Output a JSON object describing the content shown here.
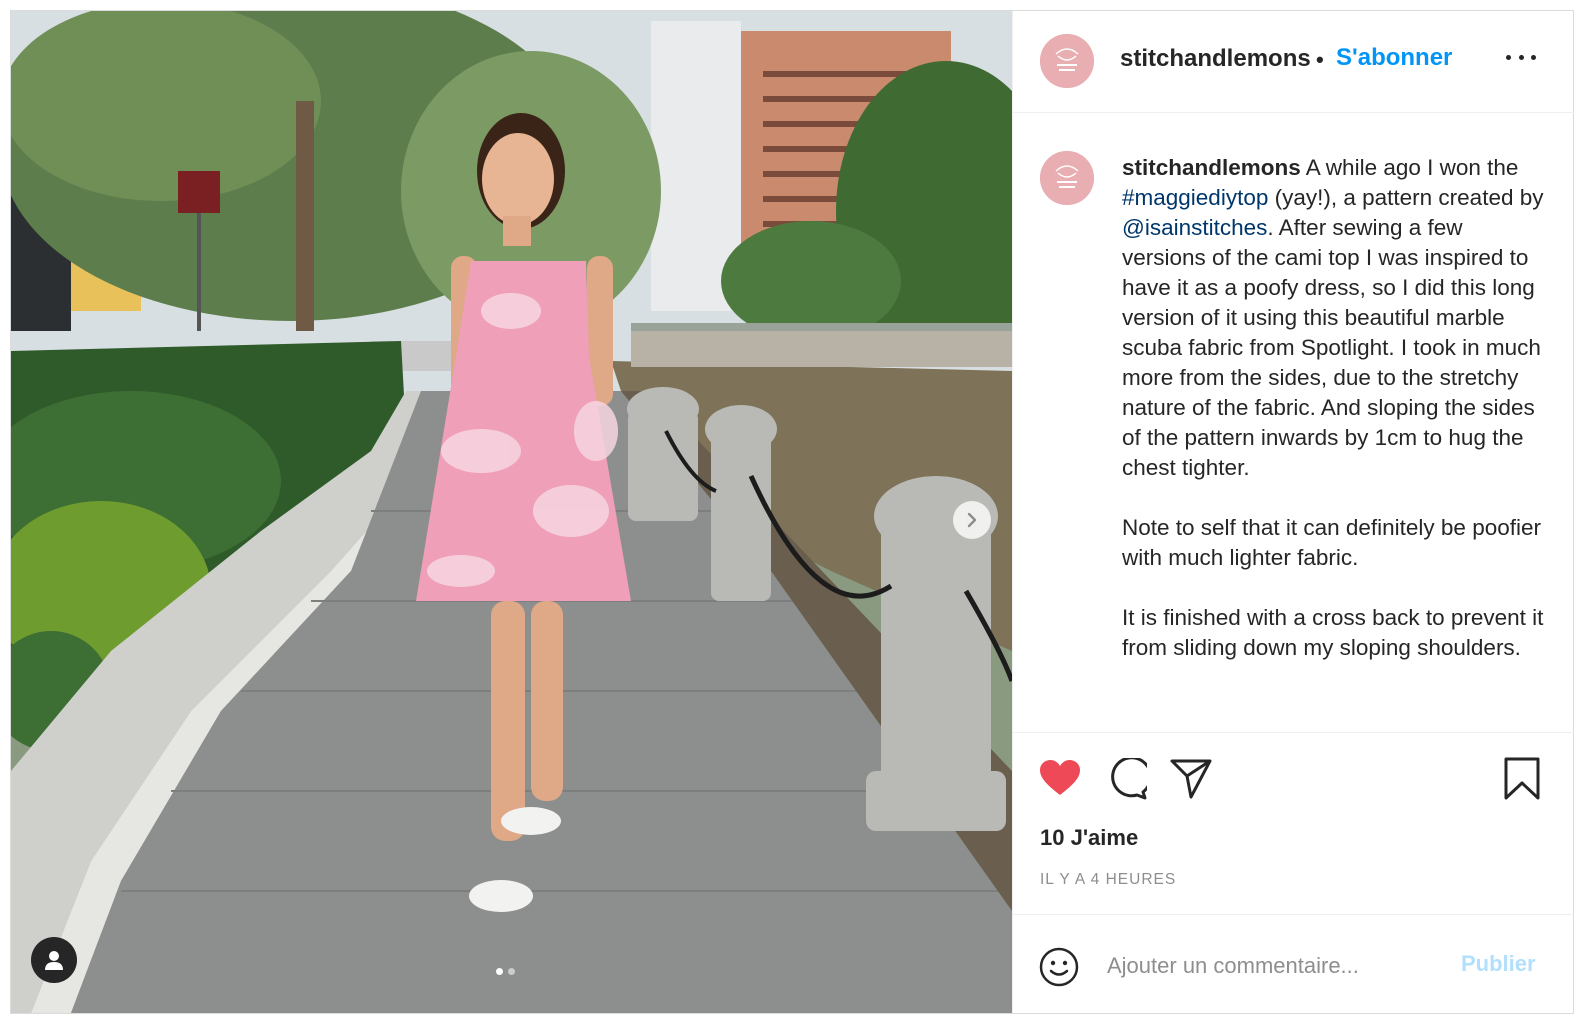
{
  "post": {
    "username": "stitchandlemons",
    "separator": "•",
    "follow_label": "S'abonner",
    "more_icon": "more-horizontal-icon"
  },
  "caption": {
    "username": "stitchandlemons",
    "paragraph1_before_hashtag": " A while ago I won the ",
    "hashtag": "#maggiediytop",
    "paragraph1_mid": " (yay!), a pattern created by ",
    "mention": "@isainstitches",
    "paragraph1_after": ". After sewing a few versions of the cami top I was inspired to have it as a poofy dress, so I did this long version of it using this beautiful marble scuba fabric from Spotlight. I took in much more from the sides, due to the stretchy nature of the fabric. And sloping the sides of the pattern inwards by 1cm to hug the chest tighter.",
    "paragraph2": "Note to self that it can definitely be poofier with much lighter fabric.",
    "paragraph3": "It is finished with a cross back to prevent it from sliding down my sloping shoulders."
  },
  "actions": {
    "like_icon": "heart-filled-icon",
    "comment_icon": "comment-icon",
    "share_icon": "paper-plane-icon",
    "save_icon": "bookmark-icon",
    "like_color": "#ed4956"
  },
  "likes_text": "10 J'aime",
  "timestamp": "IL Y A 4 HEURES",
  "comment": {
    "placeholder": "Ajouter un commentaire...",
    "publish_label": "Publier",
    "emoji_icon": "smiley-icon"
  },
  "carousel": {
    "current": 1,
    "total": 2
  },
  "colors": {
    "link_blue": "#0095f6",
    "hashtag_blue": "#00376b",
    "avatar_pink": "#e9aeb1",
    "muted_gray": "#8e8e8e"
  }
}
